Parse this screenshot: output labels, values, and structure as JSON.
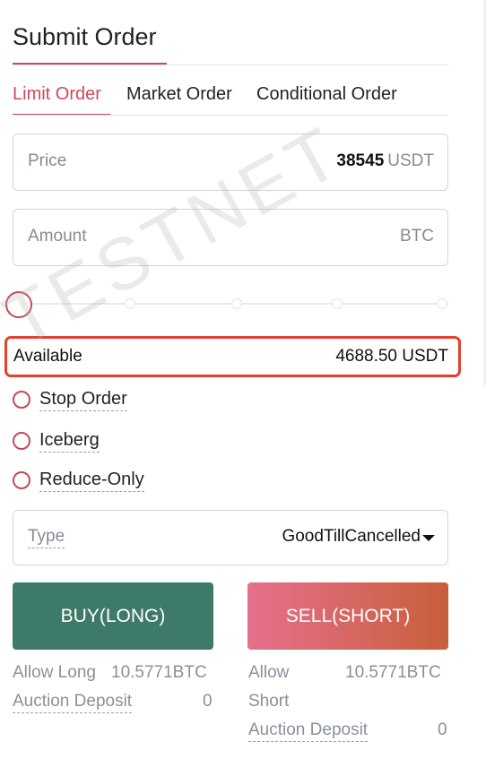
{
  "header": {
    "title": "Submit Order"
  },
  "tabs": [
    {
      "label": "Limit Order",
      "active": true
    },
    {
      "label": "Market Order",
      "active": false
    },
    {
      "label": "Conditional Order",
      "active": false
    }
  ],
  "price": {
    "label": "Price",
    "value": "38545",
    "unit": "USDT"
  },
  "amount": {
    "label": "Amount",
    "value": "",
    "unit": "BTC"
  },
  "slider": {
    "level": 0
  },
  "available": {
    "label": "Available",
    "value": "4688.50 USDT"
  },
  "options": [
    {
      "label": "Stop Order",
      "checked": false
    },
    {
      "label": "Iceberg",
      "checked": false
    },
    {
      "label": "Reduce-Only",
      "checked": false
    }
  ],
  "type_select": {
    "label": "Type",
    "value": "GoodTillCancelled"
  },
  "buy": {
    "label": "BUY(LONG)",
    "allow_label": "Allow Long",
    "allow_value": "10.5771BTC",
    "deposit_label": "Auction Deposit",
    "deposit_value": "0"
  },
  "sell": {
    "label": "SELL(SHORT)",
    "allow_label_1": "Allow",
    "allow_label_2": "Short",
    "allow_value": "10.5771BTC",
    "deposit_label": "Auction Deposit",
    "deposit_value": "0"
  },
  "watermark": "TESTNET",
  "colors": {
    "accent": "#d0485a",
    "buy": "#3e7a69",
    "sell_start": "#e66f8c",
    "sell_end": "#c85f3a",
    "highlight": "#e5402f"
  }
}
